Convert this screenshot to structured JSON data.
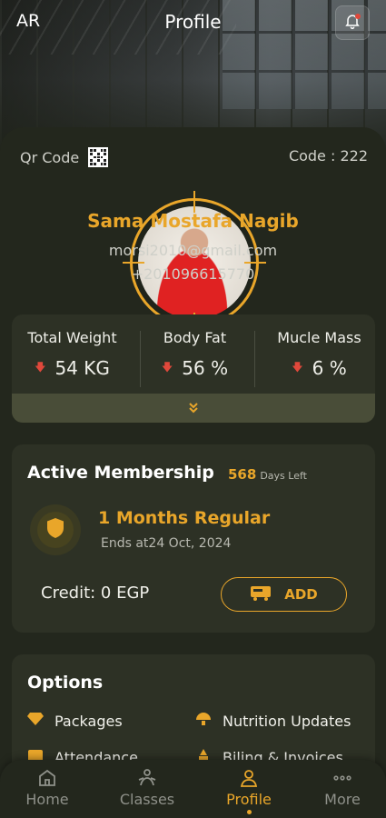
{
  "header": {
    "language": "AR",
    "title": "Profile"
  },
  "profile": {
    "qr_label": "Qr Code",
    "code_label": "Code :  222",
    "name": "Sama Mostafa Nagib",
    "email": "morsi2010@gmail.com",
    "phone": "+201096615770"
  },
  "stats": [
    {
      "label": "Total Weight",
      "value": "54 KG",
      "trend": "down"
    },
    {
      "label": "Body Fat",
      "value": "56 %",
      "trend": "down"
    },
    {
      "label": "Mucle Mass",
      "value": "6 %",
      "trend": "down"
    }
  ],
  "membership": {
    "heading": "Active Membership",
    "days_count": "568",
    "days_label": "Days Left",
    "plan": "1 Months Regular",
    "ends": "Ends at24 Oct, 2024",
    "credit": "Credit: 0 EGP",
    "add_label": "ADD"
  },
  "options": {
    "heading": "Options",
    "items": [
      {
        "label": "Packages",
        "icon": "diamond-icon"
      },
      {
        "label": "Nutrition Updates",
        "icon": "nutrition-icon"
      },
      {
        "label": "Attendance",
        "icon": "calendar-icon"
      },
      {
        "label": "Biling & Invoices",
        "icon": "invoice-icon"
      }
    ]
  },
  "nav": {
    "items": [
      {
        "label": "Home",
        "icon": "home-icon"
      },
      {
        "label": "Classes",
        "icon": "classes-icon"
      },
      {
        "label": "Profile",
        "icon": "profile-icon"
      },
      {
        "label": "More",
        "icon": "more-icon"
      }
    ],
    "active": "Profile"
  },
  "colors": {
    "accent": "#e9a62a",
    "background": "#23271d",
    "card": "#2d3125",
    "trend_down": "#e0483b"
  }
}
